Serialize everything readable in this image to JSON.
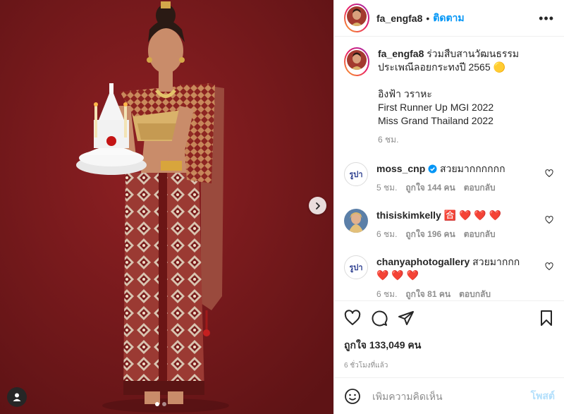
{
  "colors": {
    "accent": "#0095f6",
    "heart": "#ed4956",
    "bg_media": "#7a1a1c"
  },
  "post": {
    "username": "fa_engfa8",
    "separator": "•",
    "follow_label": "ติดตาม",
    "more_icon": "more-horizontal-icon",
    "caption": {
      "username": "fa_engfa8",
      "line1": "ร่วมสืบสานวัฒนธรรมประเพณีลอยกระทงปี 2565 🟡",
      "line2": "อิงฟ้า วราหะ",
      "line3": "First Runner Up MGI 2022",
      "line4": "Miss Grand Thailand 2022",
      "time": "6 ชม."
    }
  },
  "comments": [
    {
      "username": "moss_cnp",
      "verified": true,
      "text": "สวยมากกกกกก",
      "time": "5 ชม.",
      "likes": "ถูกใจ 144 คน",
      "reply": "ตอบกลับ",
      "avatar": "รูปา"
    },
    {
      "username": "thisiskimkelly",
      "text": "🈴 ❤️ ❤️ ❤️",
      "time": "6 ชม.",
      "likes": "ถูกใจ 196 คน",
      "reply": "ตอบกลับ"
    },
    {
      "username": "chanyaphotogallery",
      "text": "สวยมากกก",
      "text2": "❤️ ❤️ ❤️",
      "time": "6 ชม.",
      "likes": "ถูกใจ 81 คน",
      "reply": "ตอบกลับ",
      "avatar": "รูปา"
    }
  ],
  "actions": {
    "like_count": "ถูกใจ 133,049 คน",
    "timestamp": "6 ชั่วโมงที่แล้ว"
  },
  "add_comment": {
    "placeholder": "เพิ่มความคิดเห็น",
    "post_label": "โพสต์"
  }
}
